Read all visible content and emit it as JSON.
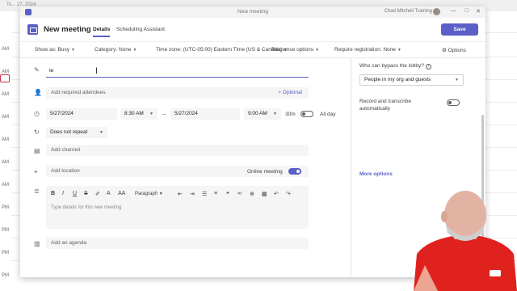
{
  "background": {
    "top_title": "To... 27, 2024",
    "hours": [
      "AM",
      "AM",
      "AM",
      "AM",
      "AM",
      "AM",
      "AM",
      "PM",
      "PM",
      "PM",
      "PM"
    ]
  },
  "window": {
    "title": "New meeting",
    "user": "Chad Mitchell Training",
    "controls": {
      "minimize": "—",
      "maximize": "□",
      "close": "✕"
    }
  },
  "header": {
    "title": "New meeting",
    "tabs": [
      {
        "label": "Details",
        "active": true
      },
      {
        "label": "Scheduling Assistant",
        "active": false
      }
    ],
    "save_label": "Save"
  },
  "options_bar": {
    "show_as": "Show as: Busy",
    "category": "Category: None",
    "time_zone": "Time zone: (UTC-05:00) Eastern Time (US & Canada)",
    "response_options": "Response options",
    "require_registration": "Require registration: None",
    "options": "Options"
  },
  "form": {
    "title_value": "te",
    "attendees_placeholder": "Add required attendees",
    "optional_label": "+ Optional",
    "start_date": "5/27/2024",
    "start_time": "8:30 AM",
    "end_date": "5/27/2024",
    "end_time": "9:00 AM",
    "duration": "30m",
    "all_day_label": "All day",
    "all_day_on": false,
    "repeat": "Does not repeat",
    "channel_placeholder": "Add channel",
    "location_placeholder": "Add location",
    "online_meeting_label": "Online meeting",
    "online_meeting_on": true,
    "paragraph_label": "Paragraph",
    "details_placeholder": "Type details for this new meeting",
    "agenda_label": "Add an agenda"
  },
  "right_panel": {
    "lobby_label": "Who can bypass the lobby?",
    "lobby_value": "People in my org and guests",
    "record_label_line1": "Record and transcribe",
    "record_label_line2": "automatically",
    "record_on": false,
    "more_options": "More options"
  },
  "colors": {
    "accent": "#5b5fc7",
    "presenter_shirt": "#e0221f"
  }
}
